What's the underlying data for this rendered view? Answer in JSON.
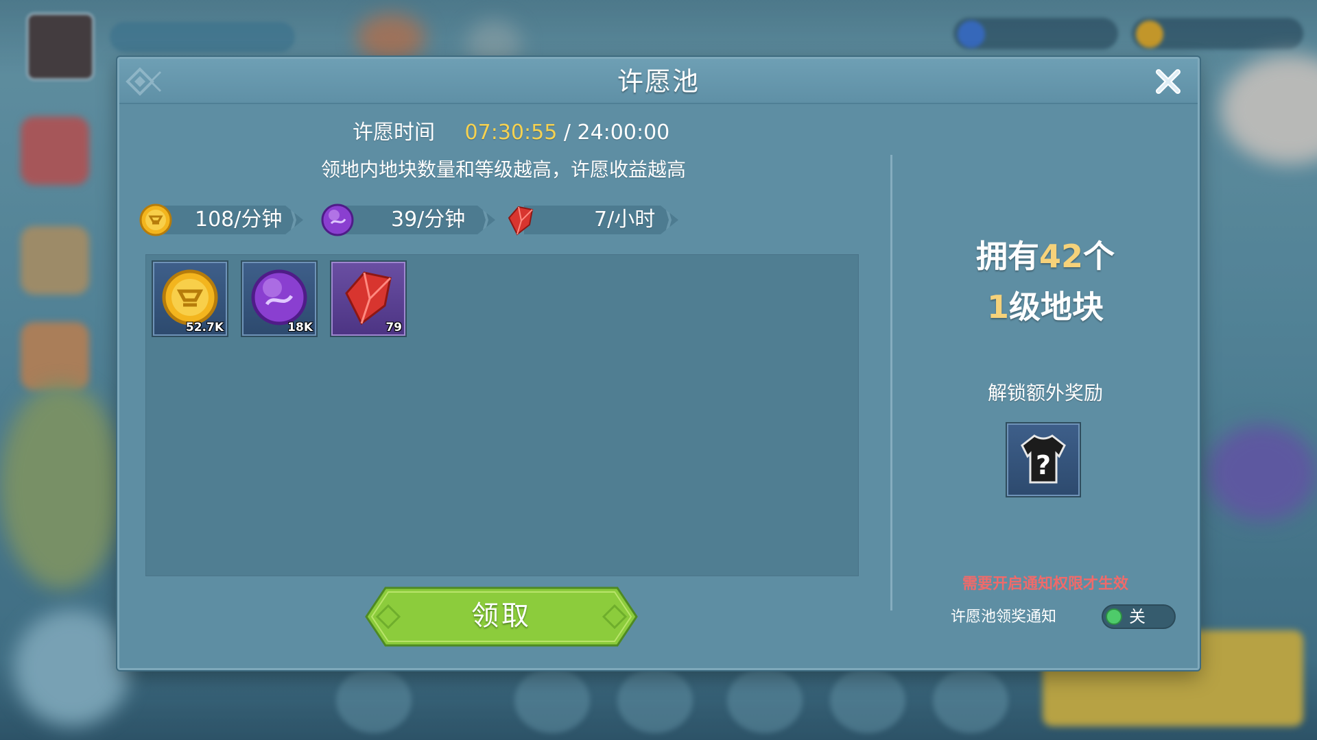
{
  "dialog": {
    "title": "许愿池"
  },
  "wish_time": {
    "label": "许愿时间",
    "current": "07:30:55",
    "separator": "/",
    "total": "24:00:00"
  },
  "hint": "领地内地块数量和等级越高，许愿收益越高",
  "rates": [
    {
      "icon": "gold-coin-icon",
      "value": "108/分钟"
    },
    {
      "icon": "purple-orb-icon",
      "value": "39/分钟"
    },
    {
      "icon": "red-crystal-icon",
      "value": "7/小时"
    }
  ],
  "rewards": [
    {
      "icon": "gold-coin-icon",
      "qty": "52.7K",
      "frame": "blue"
    },
    {
      "icon": "purple-orb-icon",
      "qty": "18K",
      "frame": "blue"
    },
    {
      "icon": "red-crystal-icon",
      "qty": "79",
      "frame": "purple"
    }
  ],
  "claim_button": "领取",
  "ownership": {
    "line1_prefix": "拥有",
    "count": "42",
    "line1_suffix": "个",
    "level": "1",
    "line2_suffix": "级地块"
  },
  "unlock_label": "解锁额外奖励",
  "mystery_reward_icon": "question-shirt-icon",
  "warning": "需要开启通知权限才生效",
  "notify": {
    "label": "许愿池领奖通知",
    "toggle_text": "关"
  },
  "colors": {
    "highlight_yellow": "#f6d251",
    "warning_red": "#f06a6a",
    "button_green": "#8ccc3c",
    "panel_blue": "#5e8ea3"
  }
}
